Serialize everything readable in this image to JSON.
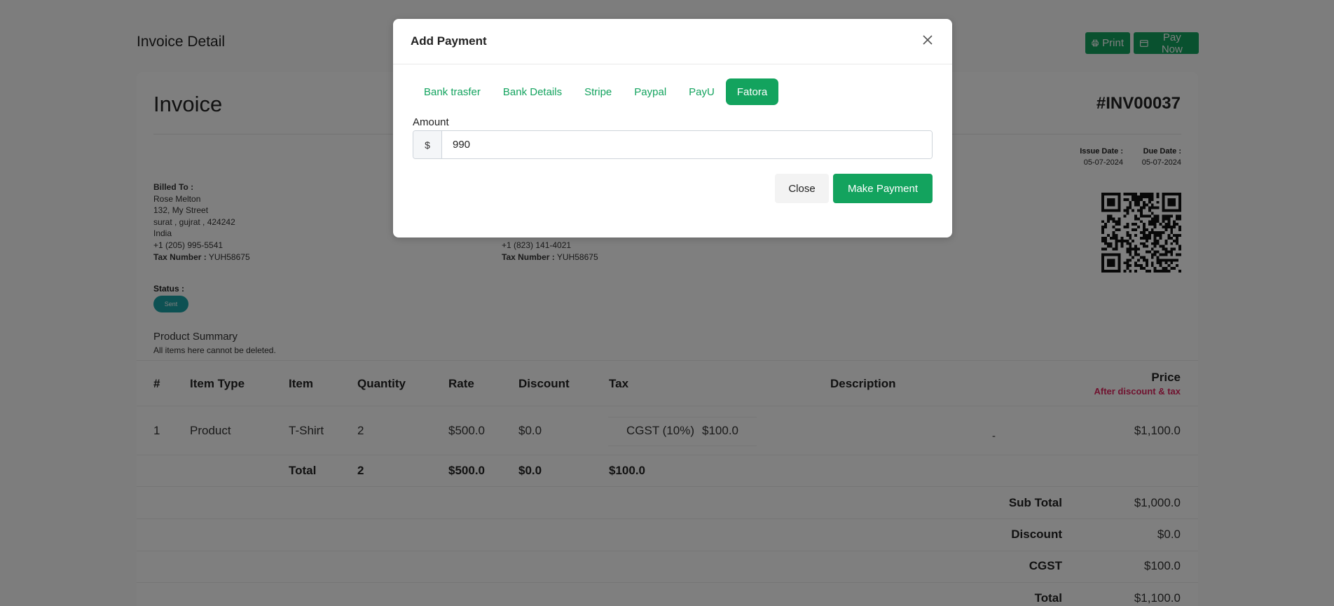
{
  "header": {
    "title": "Invoice Detail",
    "print_label": "Print",
    "pay_now_label": "Pay Now"
  },
  "invoice": {
    "heading": "Invoice",
    "number": "#INV00037",
    "issue_date_label": "Issue Date :",
    "issue_date": "05-07-2024",
    "due_date_label": "Due Date :",
    "due_date": "05-07-2024"
  },
  "billed_to": {
    "label": "Billed To :",
    "name": "Rose Melton",
    "street": "132, My Street",
    "city": "surat , gujrat , 424242",
    "country": "India",
    "phone": "+1 (205) 995-5541",
    "tax_label": "Tax Number :",
    "tax_number": "YUH58675"
  },
  "company": {
    "phone": "+1 (823) 141-4021",
    "tax_label": "Tax Number :",
    "tax_number": "YUH58675"
  },
  "status": {
    "label": "Status :",
    "value": "Sent"
  },
  "product_summary": {
    "title": "Product Summary",
    "subtitle": "All items here cannot be deleted."
  },
  "table": {
    "headers": {
      "num": "#",
      "item_type": "Item Type",
      "item": "Item",
      "quantity": "Quantity",
      "rate": "Rate",
      "discount": "Discount",
      "tax": "Tax",
      "description": "Description",
      "price": "Price",
      "price_sub": "After discount & tax"
    },
    "row": {
      "num": "1",
      "item_type": "Product",
      "item": "T-Shirt",
      "quantity": "2",
      "rate": "$500.0",
      "discount": "$0.0",
      "tax_name": "CGST (10%)",
      "tax_amount": "$100.0",
      "description": "-",
      "price": "$1,100.0"
    },
    "total_row": {
      "label": "Total",
      "quantity": "2",
      "rate": "$500.0",
      "discount": "$0.0",
      "tax": "$100.0"
    },
    "summary": [
      {
        "label": "Sub Total",
        "value": "$1,000.0"
      },
      {
        "label": "Discount",
        "value": "$0.0"
      },
      {
        "label": "CGST",
        "value": "$100.0"
      },
      {
        "label": "Total",
        "value": "$1,100.0"
      }
    ]
  },
  "modal": {
    "title": "Add Payment",
    "tabs": [
      {
        "label": "Bank trasfer",
        "active": false
      },
      {
        "label": "Bank Details",
        "active": false
      },
      {
        "label": "Stripe",
        "active": false
      },
      {
        "label": "Paypal",
        "active": false
      },
      {
        "label": "PayU",
        "active": false
      },
      {
        "label": "Fatora",
        "active": true
      }
    ],
    "amount_label": "Amount",
    "currency_prefix": "$",
    "amount_value": "990",
    "close_label": "Close",
    "make_payment_label": "Make Payment"
  },
  "colors": {
    "primary": "#13a35e",
    "status_badge": "#1ba3a6",
    "price_note": "#e0245e"
  }
}
